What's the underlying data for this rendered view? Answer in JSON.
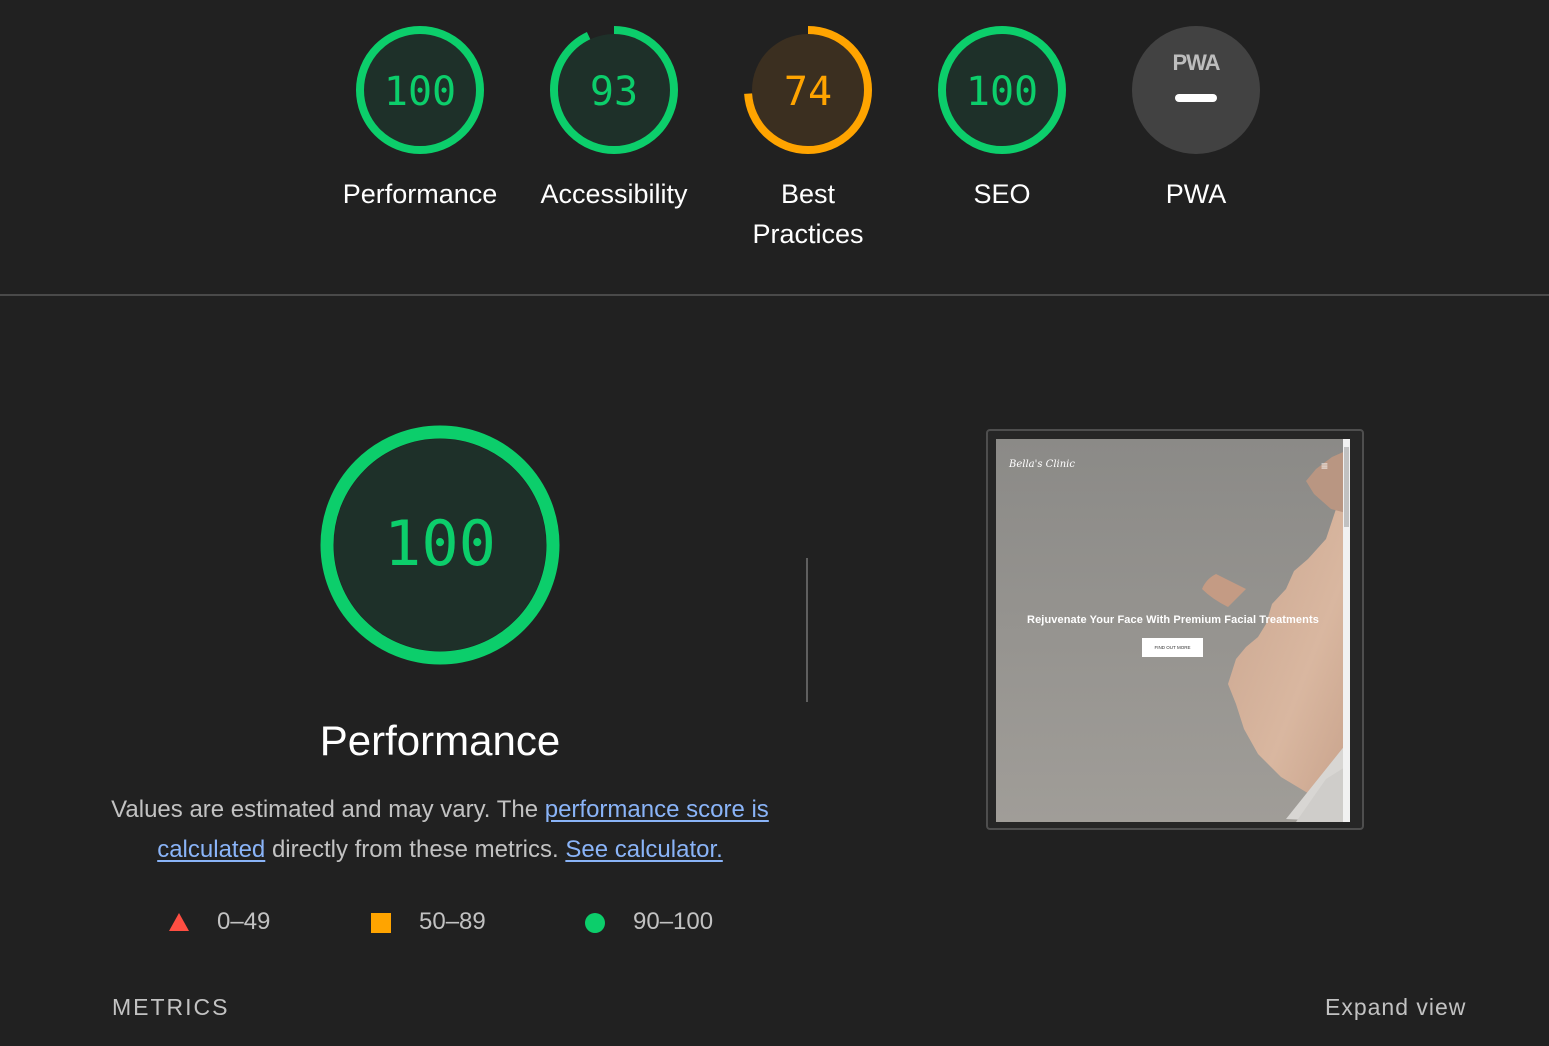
{
  "colors": {
    "pass": "#0cce6b",
    "average": "#ffa400",
    "fail": "#ff4e42",
    "pass_bg": "#1e3029",
    "average_bg": "#3b2f20",
    "na_bg": "#424242"
  },
  "categories": [
    {
      "id": "performance",
      "label": "Performance",
      "score": 100,
      "score_text": "100",
      "rating": "pass"
    },
    {
      "id": "accessibility",
      "label": "Accessibility",
      "score": 93,
      "score_text": "93",
      "rating": "pass"
    },
    {
      "id": "best-practices",
      "label": "Best Practices",
      "label_lines": [
        "Best",
        "Practices"
      ],
      "score": 74,
      "score_text": "74",
      "rating": "average"
    },
    {
      "id": "seo",
      "label": "SEO",
      "score": 100,
      "score_text": "100",
      "rating": "pass"
    },
    {
      "id": "pwa",
      "label": "PWA",
      "badge_text": "PWA",
      "rating": "not-applicable"
    }
  ],
  "performance": {
    "score_text": "100",
    "score": 100,
    "title": "Performance",
    "description_prefix": "Values are estimated and may vary. The ",
    "link_score": "performance score is calculated",
    "description_middle": " directly from these metrics. ",
    "link_calculator": "See calculator.",
    "legend": [
      {
        "shape": "triangle-icon",
        "range": "0–49",
        "color": "#ff4e42"
      },
      {
        "shape": "square-icon",
        "range": "50–89",
        "color": "#ffa400"
      },
      {
        "shape": "circle-icon",
        "range": "90–100",
        "color": "#0cce6b"
      }
    ]
  },
  "screenshot": {
    "brand": "Bella's Clinic",
    "menu_icon": "hamburger-icon",
    "headline": "Rejuvenate Your Face With Premium Facial Treatments",
    "button": "FIND OUT MORE"
  },
  "metrics": {
    "title": "METRICS",
    "expand_label": "Expand view"
  }
}
